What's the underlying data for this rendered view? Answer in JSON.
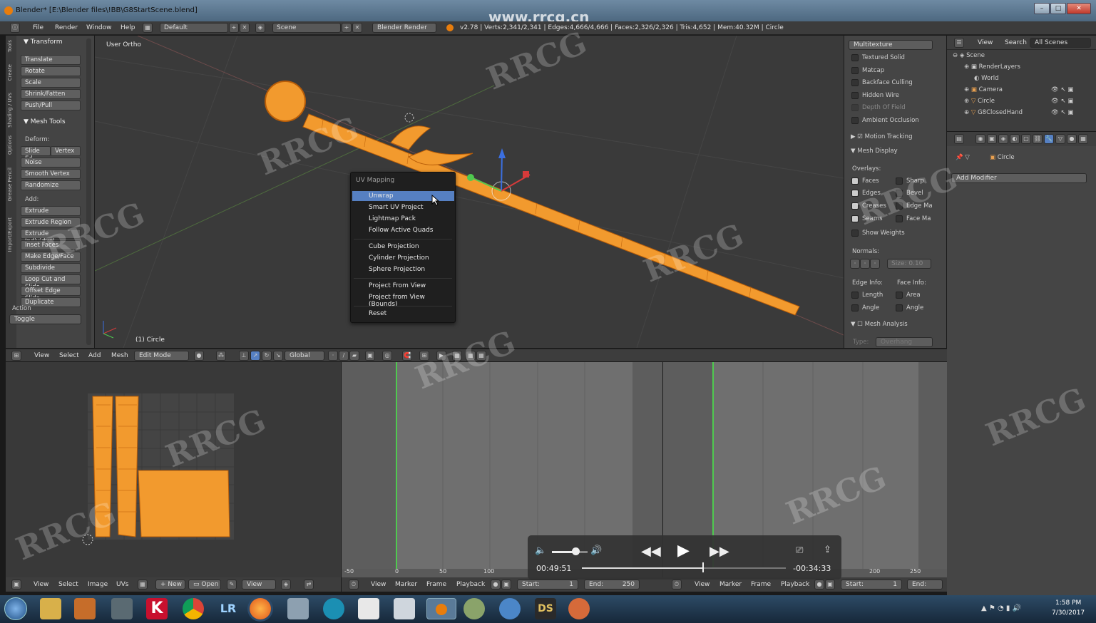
{
  "window": {
    "title": "Blender* [E:\\Blender files\\!BB\\G8StartScene.blend]",
    "watermark_url": "www.rrcg.cn"
  },
  "infobar": {
    "menus": [
      "File",
      "Render",
      "Window",
      "Help"
    ],
    "layout": "Default",
    "scene": "Scene",
    "engine": "Blender Render",
    "stats": "v2.78 | Verts:2,341/2,341 | Edges:4,666/4,666 | Faces:2,326/2,326 | Tris:4,652 | Mem:40.32M | Circle"
  },
  "toolshelf": {
    "tabs": [
      "Tools",
      "Create",
      "Shading / UVs",
      "Options",
      "Grease Pencil",
      "Import/Export"
    ],
    "transform_title": "Transform",
    "transform": [
      "Translate",
      "Rotate",
      "Scale",
      "Shrink/Fatten",
      "Push/Pull"
    ],
    "meshtools_title": "Mesh Tools",
    "deform_label": "Deform:",
    "slide_edge": "Slide Ed",
    "vertex": "Vertex",
    "deform": [
      "Noise",
      "Smooth Vertex",
      "Randomize"
    ],
    "add_label": "Add:",
    "add": [
      "Extrude",
      "Extrude Region",
      "Extrude Individual",
      "Inset Faces",
      "Make Edge/Face",
      "Subdivide",
      "Loop Cut and Slide",
      "Offset Edge Slide",
      "Duplicate"
    ],
    "action_label": "Action",
    "action_value": "Toggle"
  },
  "viewport": {
    "view_name": "User Ortho",
    "object_label": "(1) Circle"
  },
  "uv_menu": {
    "title": "UV Mapping",
    "items": [
      "Unwrap",
      "Smart UV Project",
      "Lightmap Pack",
      "Follow Active Quads",
      "Cube Projection",
      "Cylinder Projection",
      "Sphere Projection",
      "Project From View",
      "Project from View (Bounds)",
      "Reset"
    ],
    "selected": "Unwrap"
  },
  "npanel": {
    "shading": "Multitexture",
    "checks": [
      "Textured Solid",
      "Matcap",
      "Backface Culling",
      "Hidden Wire",
      "Depth Of Field",
      "Ambient Occlusion"
    ],
    "motion_tracking": "Motion Tracking",
    "mesh_display": "Mesh Display",
    "overlays": "Overlays:",
    "overlay_left": [
      "Faces",
      "Edges",
      "Creases",
      "Seams"
    ],
    "overlay_right": [
      "Sharp",
      "Bevel",
      "Edge Ma",
      "Face Ma"
    ],
    "show_weights": "Show Weights",
    "normals": "Normals:",
    "size": "Size:  0.10",
    "edge_info": "Edge Info:",
    "face_info": "Face Info:",
    "edge_items": [
      "Length",
      "Angle"
    ],
    "face_items": [
      "Area",
      "Angle"
    ],
    "mesh_analysis": "Mesh Analysis",
    "type_label": "Type:",
    "type_value": "Overhang"
  },
  "outliner": {
    "menus": [
      "View",
      "Search"
    ],
    "scenes": "All Scenes",
    "items": [
      "Scene",
      "RenderLayers",
      "World",
      "Camera",
      "Circle",
      "G8ClosedHand"
    ]
  },
  "properties": {
    "object": "Circle",
    "add_modifier": "Add Modifier"
  },
  "viewport_header": {
    "menus": [
      "View",
      "Select",
      "Add",
      "Mesh"
    ],
    "mode": "Edit Mode",
    "orientation": "Global"
  },
  "uv_header": {
    "menus": [
      "View",
      "Select",
      "Image",
      "UVs"
    ],
    "new": "New",
    "open": "Open",
    "view": "View"
  },
  "timeline": {
    "menus": [
      "View",
      "Marker",
      "Frame",
      "Playback"
    ],
    "start": "Start:",
    "start_val": "1",
    "end": "End:",
    "end_val": "250",
    "ticks_left": [
      "-50",
      "0",
      "50",
      "100"
    ],
    "ticks_right": [
      "200",
      "250"
    ]
  },
  "player": {
    "elapsed": "00:49:51",
    "remaining": "-00:34:33",
    "progress": 0.59,
    "volume": 0.65
  },
  "taskbar": {
    "time": "1:58 PM",
    "date": "7/30/2017"
  },
  "colors": {
    "accent": "#e87d0d",
    "select": "#5680c2",
    "mesh": "#f29a2e"
  }
}
